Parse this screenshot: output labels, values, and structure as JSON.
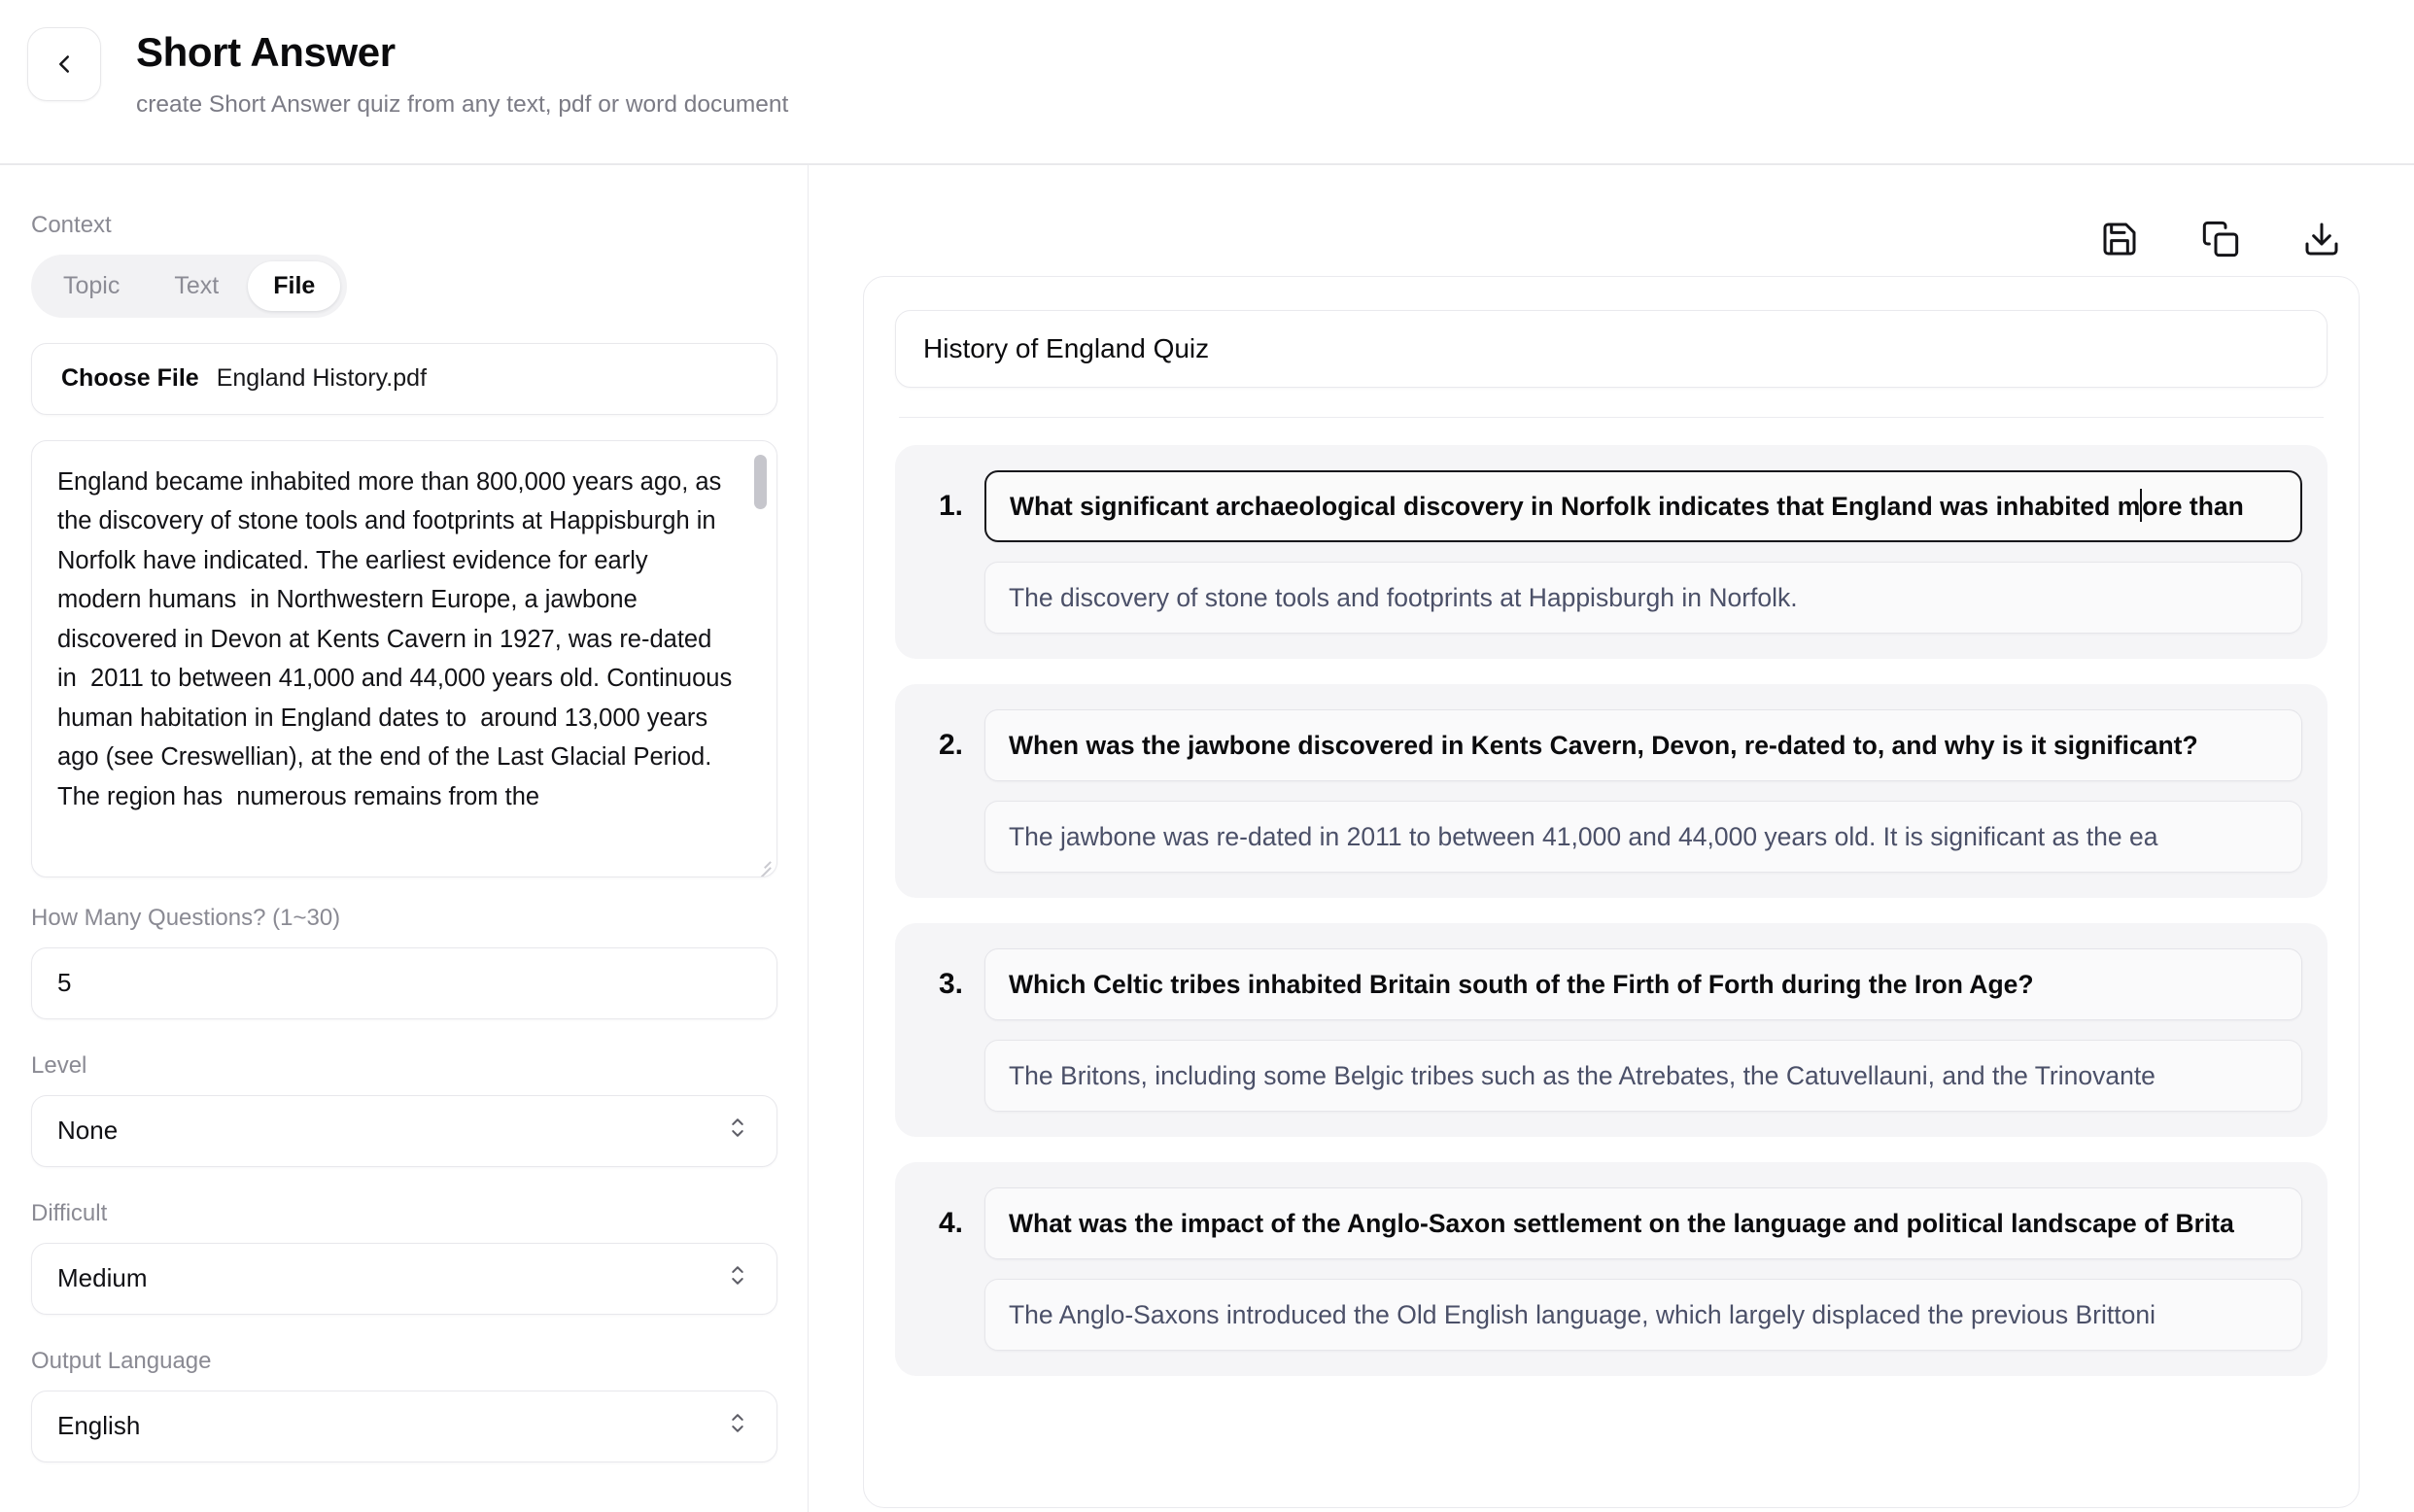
{
  "header": {
    "back_icon": "chevron-left-icon",
    "title": "Short Answer",
    "subtitle": "create Short Answer quiz from any text, pdf or word document"
  },
  "left_panel": {
    "context_label": "Context",
    "tabs": [
      {
        "label": "Topic",
        "active": false
      },
      {
        "label": "Text",
        "active": false
      },
      {
        "label": "File",
        "active": true
      }
    ],
    "file_picker": {
      "button_label": "Choose File",
      "file_name": "England History.pdf"
    },
    "context_text": "England became inhabited more than 800,000 years ago, as the discovery of stone tools and footprints at Happisburgh in Norfolk have indicated. The earliest evidence for early modern humans  in Northwestern Europe, a jawbone discovered in Devon at Kents Cavern in 1927, was re-dated in  2011 to between 41,000 and 44,000 years old. Continuous human habitation in England dates to  around 13,000 years ago (see Creswellian), at the end of the Last Glacial Period. The region has  numerous remains from the",
    "questions_count": {
      "label": "How Many Questions? (1~30)",
      "value": "5"
    },
    "level": {
      "label": "Level",
      "value": "None"
    },
    "difficult": {
      "label": "Difficult",
      "value": "Medium"
    },
    "output_language": {
      "label": "Output Language",
      "value": "English"
    }
  },
  "right_panel": {
    "toolbar": [
      {
        "name": "save-icon",
        "label": "Save"
      },
      {
        "name": "copy-icon",
        "label": "Copy"
      },
      {
        "name": "download-icon",
        "label": "Download"
      }
    ],
    "quiz_title": "History of England Quiz",
    "items": [
      {
        "number": "1.",
        "question_part1": "What significant archaeological discovery in Norfolk indicates that England was inhabited m",
        "question_part2": "ore than",
        "focused": true,
        "answer": "The discovery of stone tools and footprints at Happisburgh in Norfolk."
      },
      {
        "number": "2.",
        "question": "When was the jawbone discovered in Kents Cavern, Devon, re-dated to, and why is it significant?",
        "focused": false,
        "answer": "The jawbone was re-dated in 2011 to between 41,000 and 44,000 years old. It is significant as the ea"
      },
      {
        "number": "3.",
        "question": "Which Celtic tribes inhabited Britain south of the Firth of Forth during the Iron Age?",
        "focused": false,
        "answer": "The Britons, including some Belgic tribes such as the Atrebates, the Catuvellauni, and the Trinovante"
      },
      {
        "number": "4.",
        "question": "What was the impact of the Anglo-Saxon settlement on the language and political landscape of Brita",
        "focused": false,
        "answer": "The Anglo-Saxons introduced the Old English language, which largely displaced the previous Brittoni"
      }
    ]
  },
  "colors": {
    "text_primary": "#0b0b0d",
    "text_muted": "#8a8a93",
    "answer_text": "#4b5068",
    "card_bg": "#f5f5f7",
    "border": "#e8e8ec"
  }
}
